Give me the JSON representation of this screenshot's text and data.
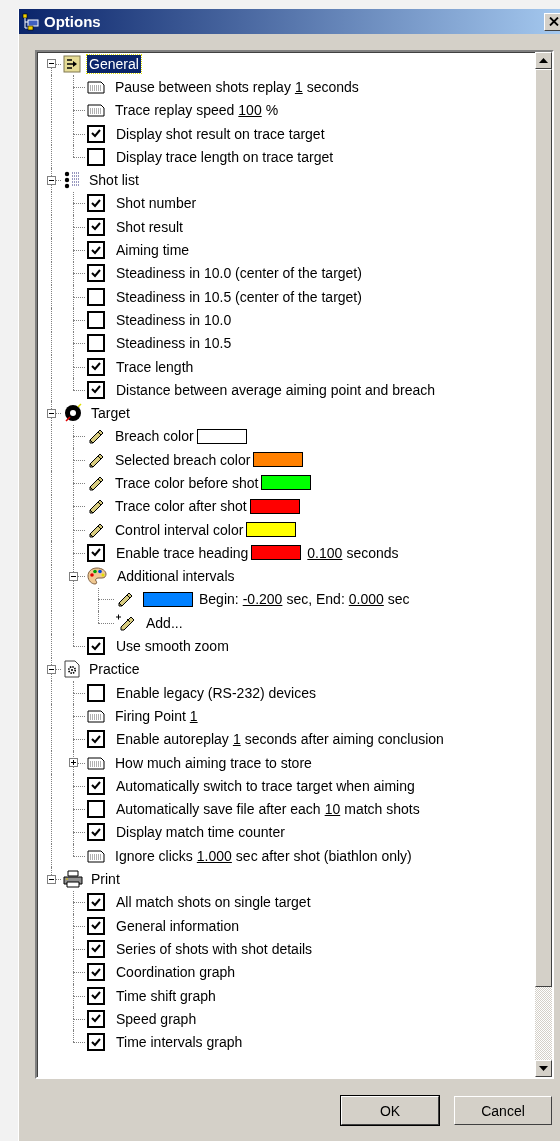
{
  "window": {
    "title": "Options"
  },
  "tree": [
    {
      "kind": "group",
      "label": "General",
      "expanded": true,
      "selected": true,
      "children": [
        {
          "kind": "edit",
          "parts": [
            {
              "kind": "text",
              "text": "Pause between shots replay"
            },
            {
              "kind": "value",
              "text": "1"
            },
            {
              "kind": "text",
              "text": "seconds"
            }
          ]
        },
        {
          "kind": "edit",
          "parts": [
            {
              "kind": "text",
              "text": "Trace replay speed"
            },
            {
              "kind": "value",
              "text": "100"
            },
            {
              "kind": "text",
              "text": "%"
            }
          ]
        },
        {
          "kind": "checkbox",
          "checked": true,
          "parts": [
            {
              "kind": "text",
              "text": "Display shot result on trace target"
            }
          ]
        },
        {
          "kind": "checkbox",
          "checked": false,
          "parts": [
            {
              "kind": "text",
              "text": "Display trace length on trace target"
            }
          ]
        }
      ]
    },
    {
      "kind": "group",
      "label": "Shot list",
      "expanded": true,
      "selected": false,
      "children": [
        {
          "kind": "checkbox",
          "checked": true,
          "parts": [
            {
              "kind": "text",
              "text": "Shot number"
            }
          ]
        },
        {
          "kind": "checkbox",
          "checked": true,
          "parts": [
            {
              "kind": "text",
              "text": "Shot result"
            }
          ]
        },
        {
          "kind": "checkbox",
          "checked": true,
          "parts": [
            {
              "kind": "text",
              "text": "Aiming time"
            }
          ]
        },
        {
          "kind": "checkbox",
          "checked": true,
          "parts": [
            {
              "kind": "text",
              "text": "Steadiness in 10.0 (center of the target)"
            }
          ]
        },
        {
          "kind": "checkbox",
          "checked": false,
          "parts": [
            {
              "kind": "text",
              "text": "Steadiness in 10.5 (center of the target)"
            }
          ]
        },
        {
          "kind": "checkbox",
          "checked": false,
          "parts": [
            {
              "kind": "text",
              "text": "Steadiness in 10.0"
            }
          ]
        },
        {
          "kind": "checkbox",
          "checked": false,
          "parts": [
            {
              "kind": "text",
              "text": "Steadiness in 10.5"
            }
          ]
        },
        {
          "kind": "checkbox",
          "checked": true,
          "parts": [
            {
              "kind": "text",
              "text": "Trace length"
            }
          ]
        },
        {
          "kind": "checkbox",
          "checked": true,
          "parts": [
            {
              "kind": "text",
              "text": "Distance between average aiming point and breach"
            }
          ]
        }
      ]
    },
    {
      "kind": "group",
      "label": "Target",
      "expanded": true,
      "selected": false,
      "children": [
        {
          "kind": "color",
          "parts": [
            {
              "kind": "text",
              "text": "Breach color"
            },
            {
              "kind": "swatch",
              "color": "#ffffff"
            }
          ]
        },
        {
          "kind": "color",
          "parts": [
            {
              "kind": "text",
              "text": "Selected breach color"
            },
            {
              "kind": "swatch",
              "color": "#ff8000"
            }
          ]
        },
        {
          "kind": "color",
          "parts": [
            {
              "kind": "text",
              "text": "Trace color before shot"
            },
            {
              "kind": "swatch",
              "color": "#00ff00"
            }
          ]
        },
        {
          "kind": "color",
          "parts": [
            {
              "kind": "text",
              "text": "Trace color after shot"
            },
            {
              "kind": "swatch",
              "color": "#ff0000"
            }
          ]
        },
        {
          "kind": "color",
          "parts": [
            {
              "kind": "text",
              "text": "Control interval color"
            },
            {
              "kind": "swatch",
              "color": "#ffff00"
            }
          ]
        },
        {
          "kind": "checkbox",
          "checked": true,
          "parts": [
            {
              "kind": "text",
              "text": "Enable trace heading"
            },
            {
              "kind": "swatch",
              "color": "#ff0000"
            },
            {
              "kind": "value",
              "text": "0.100"
            },
            {
              "kind": "text",
              "text": "seconds"
            }
          ]
        },
        {
          "kind": "subgroup",
          "expanded": true,
          "parts": [
            {
              "kind": "text",
              "text": "Additional intervals"
            }
          ],
          "children": [
            {
              "kind": "color",
              "parts": [
                {
                  "kind": "swatch",
                  "color": "#0080ff"
                },
                {
                  "kind": "text",
                  "text": "Begin:"
                },
                {
                  "kind": "value",
                  "text": "-0.200"
                },
                {
                  "kind": "text",
                  "text": "sec, End:"
                },
                {
                  "kind": "value",
                  "text": "0.000"
                },
                {
                  "kind": "text",
                  "text": "sec"
                }
              ]
            },
            {
              "kind": "add",
              "parts": [
                {
                  "kind": "text",
                  "text": "Add..."
                }
              ]
            }
          ]
        },
        {
          "kind": "checkbox",
          "checked": true,
          "parts": [
            {
              "kind": "text",
              "text": "Use smooth zoom"
            }
          ]
        }
      ]
    },
    {
      "kind": "group",
      "label": "Practice",
      "expanded": true,
      "selected": false,
      "children": [
        {
          "kind": "checkbox",
          "checked": false,
          "parts": [
            {
              "kind": "text",
              "text": "Enable legacy (RS-232) devices"
            }
          ]
        },
        {
          "kind": "edit",
          "parts": [
            {
              "kind": "text",
              "text": "Firing Point"
            },
            {
              "kind": "value",
              "text": "1"
            }
          ]
        },
        {
          "kind": "checkbox",
          "checked": true,
          "parts": [
            {
              "kind": "text",
              "text": "Enable autoreplay"
            },
            {
              "kind": "value",
              "text": "1"
            },
            {
              "kind": "text",
              "text": "seconds after aiming conclusion"
            }
          ]
        },
        {
          "kind": "edit",
          "expanded": false,
          "parts": [
            {
              "kind": "text",
              "text": "How much aiming trace to store"
            }
          ]
        },
        {
          "kind": "checkbox",
          "checked": true,
          "parts": [
            {
              "kind": "text",
              "text": "Automatically switch to trace target when aiming"
            }
          ]
        },
        {
          "kind": "checkbox",
          "checked": false,
          "parts": [
            {
              "kind": "text",
              "text": "Automatically save file after each"
            },
            {
              "kind": "value",
              "text": "10"
            },
            {
              "kind": "text",
              "text": "match shots"
            }
          ]
        },
        {
          "kind": "checkbox",
          "checked": true,
          "parts": [
            {
              "kind": "text",
              "text": "Display match time counter"
            }
          ]
        },
        {
          "kind": "edit",
          "parts": [
            {
              "kind": "text",
              "text": "Ignore clicks"
            },
            {
              "kind": "value",
              "text": "1.000"
            },
            {
              "kind": "text",
              "text": "sec after shot (biathlon only)"
            }
          ]
        }
      ]
    },
    {
      "kind": "group",
      "label": "Print",
      "expanded": true,
      "selected": false,
      "children": [
        {
          "kind": "checkbox",
          "checked": true,
          "parts": [
            {
              "kind": "text",
              "text": "All match shots on single target"
            }
          ]
        },
        {
          "kind": "checkbox",
          "checked": true,
          "parts": [
            {
              "kind": "text",
              "text": "General information"
            }
          ]
        },
        {
          "kind": "checkbox",
          "checked": true,
          "parts": [
            {
              "kind": "text",
              "text": "Series of shots with shot details"
            }
          ]
        },
        {
          "kind": "checkbox",
          "checked": true,
          "parts": [
            {
              "kind": "text",
              "text": "Coordination graph"
            }
          ]
        },
        {
          "kind": "checkbox",
          "checked": true,
          "parts": [
            {
              "kind": "text",
              "text": "Time shift graph"
            }
          ]
        },
        {
          "kind": "checkbox",
          "checked": true,
          "parts": [
            {
              "kind": "text",
              "text": "Speed graph"
            }
          ]
        },
        {
          "kind": "checkbox",
          "checked": true,
          "parts": [
            {
              "kind": "text",
              "text": "Time intervals graph"
            }
          ]
        }
      ]
    }
  ],
  "buttons": [
    {
      "label": "OK",
      "default": true
    },
    {
      "label": "Cancel",
      "default": false
    }
  ]
}
